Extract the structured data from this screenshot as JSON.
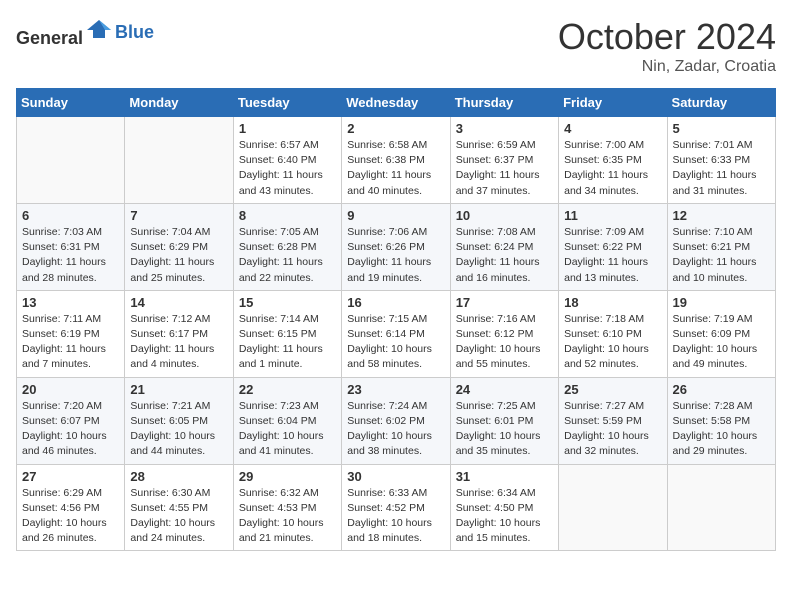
{
  "header": {
    "logo_general": "General",
    "logo_blue": "Blue",
    "month_year": "October 2024",
    "location": "Nin, Zadar, Croatia"
  },
  "columns": [
    "Sunday",
    "Monday",
    "Tuesday",
    "Wednesday",
    "Thursday",
    "Friday",
    "Saturday"
  ],
  "weeks": [
    {
      "days": [
        {
          "num": "",
          "info": ""
        },
        {
          "num": "",
          "info": ""
        },
        {
          "num": "1",
          "info": "Sunrise: 6:57 AM\nSunset: 6:40 PM\nDaylight: 11 hours and 43 minutes."
        },
        {
          "num": "2",
          "info": "Sunrise: 6:58 AM\nSunset: 6:38 PM\nDaylight: 11 hours and 40 minutes."
        },
        {
          "num": "3",
          "info": "Sunrise: 6:59 AM\nSunset: 6:37 PM\nDaylight: 11 hours and 37 minutes."
        },
        {
          "num": "4",
          "info": "Sunrise: 7:00 AM\nSunset: 6:35 PM\nDaylight: 11 hours and 34 minutes."
        },
        {
          "num": "5",
          "info": "Sunrise: 7:01 AM\nSunset: 6:33 PM\nDaylight: 11 hours and 31 minutes."
        }
      ]
    },
    {
      "days": [
        {
          "num": "6",
          "info": "Sunrise: 7:03 AM\nSunset: 6:31 PM\nDaylight: 11 hours and 28 minutes."
        },
        {
          "num": "7",
          "info": "Sunrise: 7:04 AM\nSunset: 6:29 PM\nDaylight: 11 hours and 25 minutes."
        },
        {
          "num": "8",
          "info": "Sunrise: 7:05 AM\nSunset: 6:28 PM\nDaylight: 11 hours and 22 minutes."
        },
        {
          "num": "9",
          "info": "Sunrise: 7:06 AM\nSunset: 6:26 PM\nDaylight: 11 hours and 19 minutes."
        },
        {
          "num": "10",
          "info": "Sunrise: 7:08 AM\nSunset: 6:24 PM\nDaylight: 11 hours and 16 minutes."
        },
        {
          "num": "11",
          "info": "Sunrise: 7:09 AM\nSunset: 6:22 PM\nDaylight: 11 hours and 13 minutes."
        },
        {
          "num": "12",
          "info": "Sunrise: 7:10 AM\nSunset: 6:21 PM\nDaylight: 11 hours and 10 minutes."
        }
      ]
    },
    {
      "days": [
        {
          "num": "13",
          "info": "Sunrise: 7:11 AM\nSunset: 6:19 PM\nDaylight: 11 hours and 7 minutes."
        },
        {
          "num": "14",
          "info": "Sunrise: 7:12 AM\nSunset: 6:17 PM\nDaylight: 11 hours and 4 minutes."
        },
        {
          "num": "15",
          "info": "Sunrise: 7:14 AM\nSunset: 6:15 PM\nDaylight: 11 hours and 1 minute."
        },
        {
          "num": "16",
          "info": "Sunrise: 7:15 AM\nSunset: 6:14 PM\nDaylight: 10 hours and 58 minutes."
        },
        {
          "num": "17",
          "info": "Sunrise: 7:16 AM\nSunset: 6:12 PM\nDaylight: 10 hours and 55 minutes."
        },
        {
          "num": "18",
          "info": "Sunrise: 7:18 AM\nSunset: 6:10 PM\nDaylight: 10 hours and 52 minutes."
        },
        {
          "num": "19",
          "info": "Sunrise: 7:19 AM\nSunset: 6:09 PM\nDaylight: 10 hours and 49 minutes."
        }
      ]
    },
    {
      "days": [
        {
          "num": "20",
          "info": "Sunrise: 7:20 AM\nSunset: 6:07 PM\nDaylight: 10 hours and 46 minutes."
        },
        {
          "num": "21",
          "info": "Sunrise: 7:21 AM\nSunset: 6:05 PM\nDaylight: 10 hours and 44 minutes."
        },
        {
          "num": "22",
          "info": "Sunrise: 7:23 AM\nSunset: 6:04 PM\nDaylight: 10 hours and 41 minutes."
        },
        {
          "num": "23",
          "info": "Sunrise: 7:24 AM\nSunset: 6:02 PM\nDaylight: 10 hours and 38 minutes."
        },
        {
          "num": "24",
          "info": "Sunrise: 7:25 AM\nSunset: 6:01 PM\nDaylight: 10 hours and 35 minutes."
        },
        {
          "num": "25",
          "info": "Sunrise: 7:27 AM\nSunset: 5:59 PM\nDaylight: 10 hours and 32 minutes."
        },
        {
          "num": "26",
          "info": "Sunrise: 7:28 AM\nSunset: 5:58 PM\nDaylight: 10 hours and 29 minutes."
        }
      ]
    },
    {
      "days": [
        {
          "num": "27",
          "info": "Sunrise: 6:29 AM\nSunset: 4:56 PM\nDaylight: 10 hours and 26 minutes."
        },
        {
          "num": "28",
          "info": "Sunrise: 6:30 AM\nSunset: 4:55 PM\nDaylight: 10 hours and 24 minutes."
        },
        {
          "num": "29",
          "info": "Sunrise: 6:32 AM\nSunset: 4:53 PM\nDaylight: 10 hours and 21 minutes."
        },
        {
          "num": "30",
          "info": "Sunrise: 6:33 AM\nSunset: 4:52 PM\nDaylight: 10 hours and 18 minutes."
        },
        {
          "num": "31",
          "info": "Sunrise: 6:34 AM\nSunset: 4:50 PM\nDaylight: 10 hours and 15 minutes."
        },
        {
          "num": "",
          "info": ""
        },
        {
          "num": "",
          "info": ""
        }
      ]
    }
  ]
}
